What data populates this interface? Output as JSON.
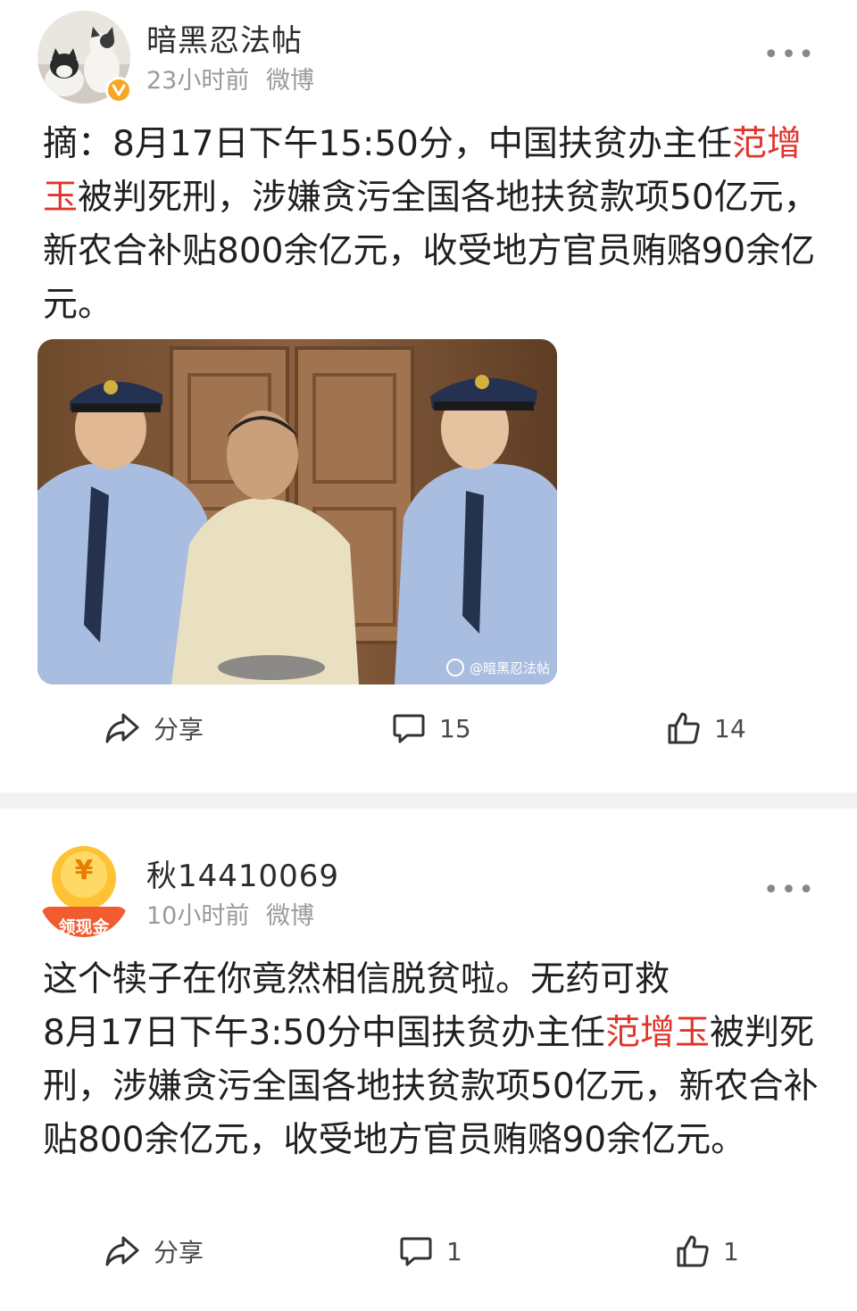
{
  "posts": [
    {
      "username": "暗黑忍法帖",
      "time": "23小时前",
      "source": "微博",
      "more": "•••",
      "text_parts": [
        "摘：8月17日下午15:50分，中国扶贫办主任",
        "范增玉",
        "被判死刑，涉嫌贪污全国各地扶贫款项50亿元，新农合补贴800余亿元，收受地方官员贿赂90余亿元。"
      ],
      "highlight_color": "#e0352b",
      "image_watermark": "@暗黑忍法帖",
      "actions": {
        "share": "分享",
        "comments": "15",
        "likes": "14"
      }
    },
    {
      "username": "秋14410069",
      "time": "10小时前",
      "source": "微博",
      "more": "•••",
      "avatar_badge": "领现金",
      "avatar_coin": "¥",
      "text_line1": "这个犊子在你竟然相信脱贫啦。无药可救",
      "text_parts": [
        "8月17日下午3:50分中国扶贫办主任",
        "范增玉",
        "被判死刑，涉嫌贪污全国各地扶贫款项50亿元，新农合补贴800余亿元，收受地方官员贿赂90余亿元。"
      ],
      "actions": {
        "share": "分享",
        "comments": "1",
        "likes": "1"
      }
    }
  ],
  "colors": {
    "accent_red": "#e0352b",
    "verified_badge": "#f5a623",
    "divider": "#f2f2f2"
  }
}
